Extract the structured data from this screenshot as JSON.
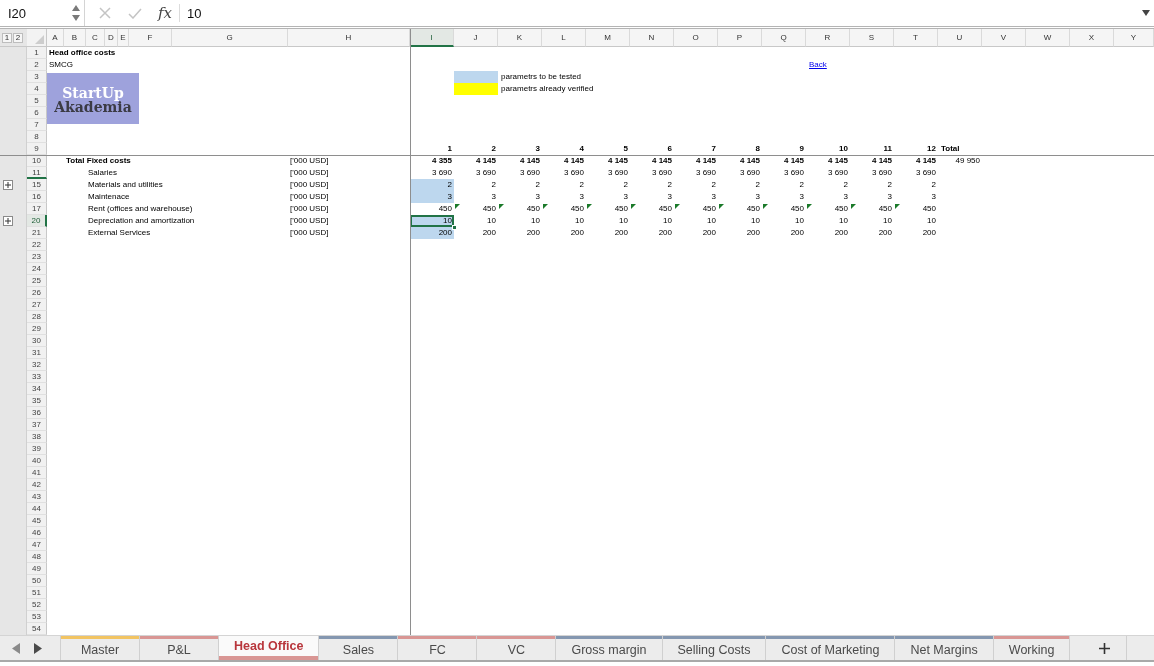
{
  "formula_bar": {
    "name_box": "I20",
    "function_label": "fx",
    "value": "10"
  },
  "outline_levels": [
    {
      "label": "1"
    },
    {
      "label": "2"
    }
  ],
  "columns": [
    {
      "label": "A",
      "selected": false
    },
    {
      "label": "B",
      "selected": false
    },
    {
      "label": "C",
      "selected": false
    },
    {
      "label": "D",
      "selected": false
    },
    {
      "label": "E",
      "selected": false
    },
    {
      "label": "F",
      "selected": false
    },
    {
      "label": "G",
      "selected": false
    },
    {
      "label": "H",
      "selected": false
    },
    {
      "label": "I",
      "selected": true
    },
    {
      "label": "J",
      "selected": false
    },
    {
      "label": "K",
      "selected": false
    },
    {
      "label": "L",
      "selected": false
    },
    {
      "label": "M",
      "selected": false
    },
    {
      "label": "N",
      "selected": false
    },
    {
      "label": "O",
      "selected": false
    },
    {
      "label": "P",
      "selected": false
    },
    {
      "label": "Q",
      "selected": false
    },
    {
      "label": "R",
      "selected": false
    },
    {
      "label": "S",
      "selected": false
    },
    {
      "label": "T",
      "selected": false
    },
    {
      "label": "U",
      "selected": false
    },
    {
      "label": "V",
      "selected": false
    },
    {
      "label": "W",
      "selected": false
    },
    {
      "label": "X",
      "selected": false
    },
    {
      "label": "Y",
      "selected": false
    }
  ],
  "row_headers": [
    {
      "number": "1",
      "selected": false,
      "group_collapsed": false,
      "highlighted_edge": false
    },
    {
      "number": "2",
      "selected": false,
      "group_collapsed": false,
      "highlighted_edge": false
    },
    {
      "number": "3",
      "selected": false,
      "group_collapsed": false,
      "highlighted_edge": false
    },
    {
      "number": "4",
      "selected": false,
      "group_collapsed": false,
      "highlighted_edge": false
    },
    {
      "number": "5",
      "selected": false,
      "group_collapsed": false,
      "highlighted_edge": false
    },
    {
      "number": "6",
      "selected": false,
      "group_collapsed": false,
      "highlighted_edge": false
    },
    {
      "number": "7",
      "selected": false,
      "group_collapsed": false,
      "highlighted_edge": false
    },
    {
      "number": "8",
      "selected": false,
      "group_collapsed": false,
      "highlighted_edge": false
    },
    {
      "number": "9",
      "selected": false,
      "group_collapsed": false,
      "highlighted_edge": false
    },
    {
      "number": "10",
      "selected": false,
      "group_collapsed": false,
      "highlighted_edge": false
    },
    {
      "number": "11",
      "selected": false,
      "group_collapsed": false,
      "highlighted_edge": true
    },
    {
      "number": "15",
      "selected": false,
      "group_collapsed": true,
      "highlighted_edge": false
    },
    {
      "number": "16",
      "selected": false,
      "group_collapsed": false,
      "highlighted_edge": false
    },
    {
      "number": "17",
      "selected": false,
      "group_collapsed": false,
      "highlighted_edge": false
    },
    {
      "number": "20",
      "selected": true,
      "group_collapsed": true,
      "highlighted_edge": false
    },
    {
      "number": "21",
      "selected": false,
      "group_collapsed": false,
      "highlighted_edge": false
    },
    {
      "number": "22",
      "selected": false,
      "group_collapsed": false,
      "highlighted_edge": false
    },
    {
      "number": "23",
      "selected": false,
      "group_collapsed": false,
      "highlighted_edge": false
    },
    {
      "number": "24",
      "selected": false,
      "group_collapsed": false,
      "highlighted_edge": false
    },
    {
      "number": "25",
      "selected": false,
      "group_collapsed": false,
      "highlighted_edge": false
    },
    {
      "number": "26",
      "selected": false,
      "group_collapsed": false,
      "highlighted_edge": false
    },
    {
      "number": "27",
      "selected": false,
      "group_collapsed": false,
      "highlighted_edge": false
    },
    {
      "number": "28",
      "selected": false,
      "group_collapsed": false,
      "highlighted_edge": false
    },
    {
      "number": "29",
      "selected": false,
      "group_collapsed": false,
      "highlighted_edge": false
    },
    {
      "number": "30",
      "selected": false,
      "group_collapsed": false,
      "highlighted_edge": false
    },
    {
      "number": "31",
      "selected": false,
      "group_collapsed": false,
      "highlighted_edge": false
    },
    {
      "number": "32",
      "selected": false,
      "group_collapsed": false,
      "highlighted_edge": false
    },
    {
      "number": "33",
      "selected": false,
      "group_collapsed": false,
      "highlighted_edge": false
    },
    {
      "number": "34",
      "selected": false,
      "group_collapsed": false,
      "highlighted_edge": false
    },
    {
      "number": "35",
      "selected": false,
      "group_collapsed": false,
      "highlighted_edge": false
    },
    {
      "number": "36",
      "selected": false,
      "group_collapsed": false,
      "highlighted_edge": false
    },
    {
      "number": "37",
      "selected": false,
      "group_collapsed": false,
      "highlighted_edge": false
    },
    {
      "number": "38",
      "selected": false,
      "group_collapsed": false,
      "highlighted_edge": false
    },
    {
      "number": "39",
      "selected": false,
      "group_collapsed": false,
      "highlighted_edge": false
    },
    {
      "number": "40",
      "selected": false,
      "group_collapsed": false,
      "highlighted_edge": false
    },
    {
      "number": "41",
      "selected": false,
      "group_collapsed": false,
      "highlighted_edge": false
    },
    {
      "number": "42",
      "selected": false,
      "group_collapsed": false,
      "highlighted_edge": false
    },
    {
      "number": "43",
      "selected": false,
      "group_collapsed": false,
      "highlighted_edge": false
    },
    {
      "number": "44",
      "selected": false,
      "group_collapsed": false,
      "highlighted_edge": false
    },
    {
      "number": "45",
      "selected": false,
      "group_collapsed": false,
      "highlighted_edge": false
    },
    {
      "number": "46",
      "selected": false,
      "group_collapsed": false,
      "highlighted_edge": false
    },
    {
      "number": "47",
      "selected": false,
      "group_collapsed": false,
      "highlighted_edge": false
    },
    {
      "number": "48",
      "selected": false,
      "group_collapsed": false,
      "highlighted_edge": false
    },
    {
      "number": "49",
      "selected": false,
      "group_collapsed": false,
      "highlighted_edge": false
    },
    {
      "number": "50",
      "selected": false,
      "group_collapsed": false,
      "highlighted_edge": false
    },
    {
      "number": "51",
      "selected": false,
      "group_collapsed": false,
      "highlighted_edge": false
    },
    {
      "number": "52",
      "selected": false,
      "group_collapsed": false,
      "highlighted_edge": false
    },
    {
      "number": "53",
      "selected": false,
      "group_collapsed": false,
      "highlighted_edge": false
    },
    {
      "number": "54",
      "selected": false,
      "group_collapsed": false,
      "highlighted_edge": false
    }
  ],
  "sheet": {
    "title": "Head office costs",
    "subtitle": "SMCG",
    "back_link": "Back"
  },
  "logo": {
    "title": "StartUp",
    "subtitle": "Akademia"
  },
  "legend": [
    {
      "label": "parametrs to be tested",
      "color": "#bdd7ee"
    },
    {
      "label": "parametrs already verified",
      "color": "#ffff00"
    }
  ],
  "table": {
    "periods": [
      "1",
      "2",
      "3",
      "4",
      "5",
      "6",
      "7",
      "8",
      "9",
      "10",
      "11",
      "12"
    ],
    "total_label": "Total",
    "lines": [
      {
        "kind": "total",
        "label": "Total Fixed costs",
        "unit": "['000 USD]",
        "total": "49 950",
        "cells": [
          {
            "text": "4 355",
            "tested": false,
            "flagged": false,
            "selected": false
          },
          {
            "text": "4 145",
            "tested": false,
            "flagged": false,
            "selected": false
          },
          {
            "text": "4 145",
            "tested": false,
            "flagged": false,
            "selected": false
          },
          {
            "text": "4 145",
            "tested": false,
            "flagged": false,
            "selected": false
          },
          {
            "text": "4 145",
            "tested": false,
            "flagged": false,
            "selected": false
          },
          {
            "text": "4 145",
            "tested": false,
            "flagged": false,
            "selected": false
          },
          {
            "text": "4 145",
            "tested": false,
            "flagged": false,
            "selected": false
          },
          {
            "text": "4 145",
            "tested": false,
            "flagged": false,
            "selected": false
          },
          {
            "text": "4 145",
            "tested": false,
            "flagged": false,
            "selected": false
          },
          {
            "text": "4 145",
            "tested": false,
            "flagged": false,
            "selected": false
          },
          {
            "text": "4 145",
            "tested": false,
            "flagged": false,
            "selected": false
          },
          {
            "text": "4 145",
            "tested": false,
            "flagged": false,
            "selected": false
          }
        ]
      },
      {
        "kind": "item",
        "label": "Salaries",
        "unit": "['000 USD]",
        "cells": [
          {
            "text": "3 690",
            "tested": false,
            "flagged": false,
            "selected": false
          },
          {
            "text": "3 690",
            "tested": false,
            "flagged": false,
            "selected": false
          },
          {
            "text": "3 690",
            "tested": false,
            "flagged": false,
            "selected": false
          },
          {
            "text": "3 690",
            "tested": false,
            "flagged": false,
            "selected": false
          },
          {
            "text": "3 690",
            "tested": false,
            "flagged": false,
            "selected": false
          },
          {
            "text": "3 690",
            "tested": false,
            "flagged": false,
            "selected": false
          },
          {
            "text": "3 690",
            "tested": false,
            "flagged": false,
            "selected": false
          },
          {
            "text": "3 690",
            "tested": false,
            "flagged": false,
            "selected": false
          },
          {
            "text": "3 690",
            "tested": false,
            "flagged": false,
            "selected": false
          },
          {
            "text": "3 690",
            "tested": false,
            "flagged": false,
            "selected": false
          },
          {
            "text": "3 690",
            "tested": false,
            "flagged": false,
            "selected": false
          },
          {
            "text": "3 690",
            "tested": false,
            "flagged": false,
            "selected": false
          }
        ]
      },
      {
        "kind": "item",
        "label": "Materials and utilities",
        "unit": "['000 USD]",
        "cells": [
          {
            "text": "2",
            "tested": true,
            "flagged": false,
            "selected": false
          },
          {
            "text": "2",
            "tested": false,
            "flagged": false,
            "selected": false
          },
          {
            "text": "2",
            "tested": false,
            "flagged": false,
            "selected": false
          },
          {
            "text": "2",
            "tested": false,
            "flagged": false,
            "selected": false
          },
          {
            "text": "2",
            "tested": false,
            "flagged": false,
            "selected": false
          },
          {
            "text": "2",
            "tested": false,
            "flagged": false,
            "selected": false
          },
          {
            "text": "2",
            "tested": false,
            "flagged": false,
            "selected": false
          },
          {
            "text": "2",
            "tested": false,
            "flagged": false,
            "selected": false
          },
          {
            "text": "2",
            "tested": false,
            "flagged": false,
            "selected": false
          },
          {
            "text": "2",
            "tested": false,
            "flagged": false,
            "selected": false
          },
          {
            "text": "2",
            "tested": false,
            "flagged": false,
            "selected": false
          },
          {
            "text": "2",
            "tested": false,
            "flagged": false,
            "selected": false
          }
        ]
      },
      {
        "kind": "item",
        "label": "Maintenace",
        "unit": "['000 USD]",
        "cells": [
          {
            "text": "3",
            "tested": true,
            "flagged": false,
            "selected": false
          },
          {
            "text": "3",
            "tested": false,
            "flagged": false,
            "selected": false
          },
          {
            "text": "3",
            "tested": false,
            "flagged": false,
            "selected": false
          },
          {
            "text": "3",
            "tested": false,
            "flagged": false,
            "selected": false
          },
          {
            "text": "3",
            "tested": false,
            "flagged": false,
            "selected": false
          },
          {
            "text": "3",
            "tested": false,
            "flagged": false,
            "selected": false
          },
          {
            "text": "3",
            "tested": false,
            "flagged": false,
            "selected": false
          },
          {
            "text": "3",
            "tested": false,
            "flagged": false,
            "selected": false
          },
          {
            "text": "3",
            "tested": false,
            "flagged": false,
            "selected": false
          },
          {
            "text": "3",
            "tested": false,
            "flagged": false,
            "selected": false
          },
          {
            "text": "3",
            "tested": false,
            "flagged": false,
            "selected": false
          },
          {
            "text": "3",
            "tested": false,
            "flagged": false,
            "selected": false
          }
        ]
      },
      {
        "kind": "item",
        "label": "Rent (offices and warehouse)",
        "unit": "['000 USD]",
        "cells": [
          {
            "text": "450",
            "tested": false,
            "flagged": false,
            "selected": false
          },
          {
            "text": "450",
            "tested": false,
            "flagged": true,
            "selected": false
          },
          {
            "text": "450",
            "tested": false,
            "flagged": true,
            "selected": false
          },
          {
            "text": "450",
            "tested": false,
            "flagged": true,
            "selected": false
          },
          {
            "text": "450",
            "tested": false,
            "flagged": true,
            "selected": false
          },
          {
            "text": "450",
            "tested": false,
            "flagged": true,
            "selected": false
          },
          {
            "text": "450",
            "tested": false,
            "flagged": true,
            "selected": false
          },
          {
            "text": "450",
            "tested": false,
            "flagged": true,
            "selected": false
          },
          {
            "text": "450",
            "tested": false,
            "flagged": true,
            "selected": false
          },
          {
            "text": "450",
            "tested": false,
            "flagged": true,
            "selected": false
          },
          {
            "text": "450",
            "tested": false,
            "flagged": true,
            "selected": false
          },
          {
            "text": "450",
            "tested": false,
            "flagged": true,
            "selected": false
          }
        ]
      },
      {
        "kind": "item",
        "label": "Depreciation and amortization",
        "unit": "['000 USD]",
        "cells": [
          {
            "text": "10",
            "tested": true,
            "flagged": false,
            "selected": true
          },
          {
            "text": "10",
            "tested": false,
            "flagged": false,
            "selected": false
          },
          {
            "text": "10",
            "tested": false,
            "flagged": false,
            "selected": false
          },
          {
            "text": "10",
            "tested": false,
            "flagged": false,
            "selected": false
          },
          {
            "text": "10",
            "tested": false,
            "flagged": false,
            "selected": false
          },
          {
            "text": "10",
            "tested": false,
            "flagged": false,
            "selected": false
          },
          {
            "text": "10",
            "tested": false,
            "flagged": false,
            "selected": false
          },
          {
            "text": "10",
            "tested": false,
            "flagged": false,
            "selected": false
          },
          {
            "text": "10",
            "tested": false,
            "flagged": false,
            "selected": false
          },
          {
            "text": "10",
            "tested": false,
            "flagged": false,
            "selected": false
          },
          {
            "text": "10",
            "tested": false,
            "flagged": false,
            "selected": false
          },
          {
            "text": "10",
            "tested": false,
            "flagged": false,
            "selected": false
          }
        ]
      },
      {
        "kind": "item",
        "label": "External Services",
        "unit": "['000 USD]",
        "cells": [
          {
            "text": "200",
            "tested": true,
            "flagged": false,
            "selected": false
          },
          {
            "text": "200",
            "tested": false,
            "flagged": false,
            "selected": false
          },
          {
            "text": "200",
            "tested": false,
            "flagged": false,
            "selected": false
          },
          {
            "text": "200",
            "tested": false,
            "flagged": false,
            "selected": false
          },
          {
            "text": "200",
            "tested": false,
            "flagged": false,
            "selected": false
          },
          {
            "text": "200",
            "tested": false,
            "flagged": false,
            "selected": false
          },
          {
            "text": "200",
            "tested": false,
            "flagged": false,
            "selected": false
          },
          {
            "text": "200",
            "tested": false,
            "flagged": false,
            "selected": false
          },
          {
            "text": "200",
            "tested": false,
            "flagged": false,
            "selected": false
          },
          {
            "text": "200",
            "tested": false,
            "flagged": false,
            "selected": false
          },
          {
            "text": "200",
            "tested": false,
            "flagged": false,
            "selected": false
          },
          {
            "text": "200",
            "tested": false,
            "flagged": false,
            "selected": false
          }
        ]
      }
    ]
  },
  "sheet_tabs": [
    {
      "label": "Master",
      "color": "#f2c462",
      "selected": false
    },
    {
      "label": "P&L",
      "color": "#d99694",
      "selected": false
    },
    {
      "label": "Head Office",
      "color": "#d99694",
      "selected": true
    },
    {
      "label": "Sales",
      "color": "#8497b0",
      "selected": false
    },
    {
      "label": "FC",
      "color": "#d99694",
      "selected": false
    },
    {
      "label": "VC",
      "color": "#d99694",
      "selected": false
    },
    {
      "label": "Gross margin",
      "color": "#8497b0",
      "selected": false
    },
    {
      "label": "Selling Costs",
      "color": "#8497b0",
      "selected": false
    },
    {
      "label": "Cost of Marketing",
      "color": "#8497b0",
      "selected": false
    },
    {
      "label": "Net Margins",
      "color": "#8497b0",
      "selected": false
    },
    {
      "label": "Working",
      "color": "#d99694",
      "selected": false
    }
  ]
}
